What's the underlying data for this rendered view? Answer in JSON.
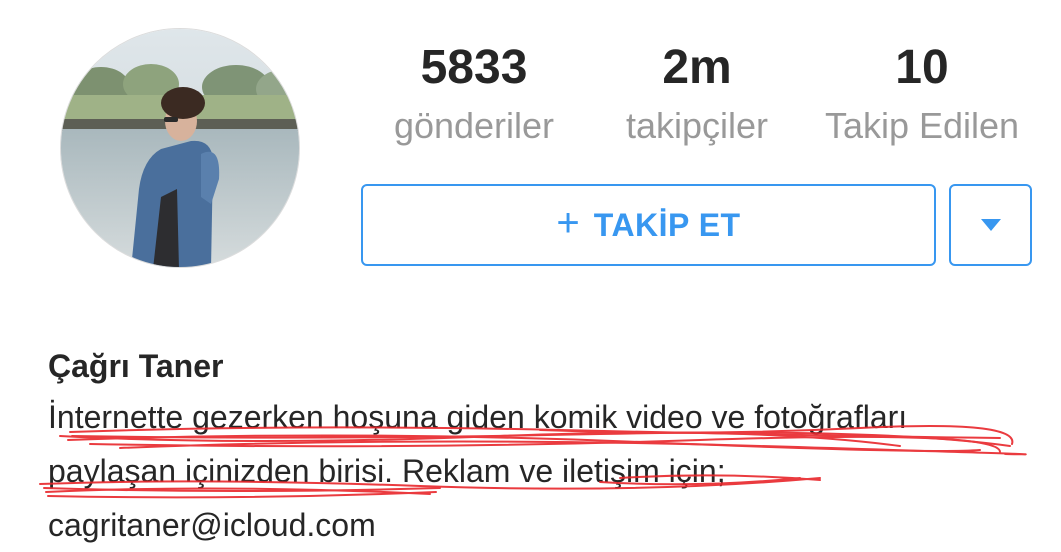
{
  "profile": {
    "stats": [
      {
        "count": "5833",
        "label": "gönderiler"
      },
      {
        "count": "2m",
        "label": "takipçiler"
      },
      {
        "count": "10",
        "label": "Takip Edilen"
      }
    ],
    "follow_button": {
      "icon": "plus-icon",
      "label": "TAKİP ET"
    },
    "dropdown_button": {
      "icon": "caret-down-icon"
    },
    "name": "Çağrı Taner",
    "bio_lines": [
      "İnternette gezerken hoşuna giden komik video ve fotoğrafları",
      "paylaşan içinizden birisi. Reklam ve iletişim için;",
      "cagritaner@icloud.com"
    ]
  },
  "colors": {
    "accent": "#3897f0",
    "text": "#262626",
    "muted": "#999999",
    "scribble": "#e8262b"
  }
}
